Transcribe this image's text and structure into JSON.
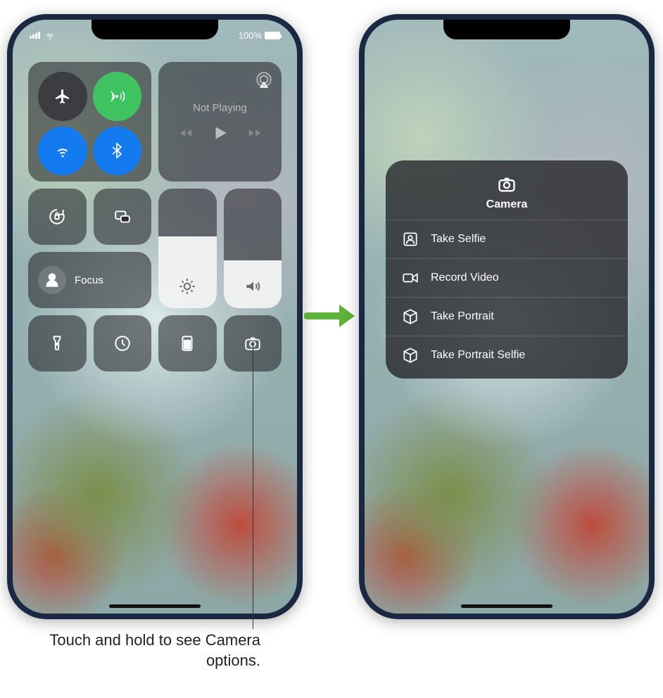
{
  "status": {
    "battery_pct": "100%"
  },
  "media": {
    "label": "Not Playing"
  },
  "focus": {
    "label": "Focus"
  },
  "sliders": {
    "brightness_pct": 60,
    "volume_pct": 40
  },
  "camera_menu": {
    "title": "Camera",
    "items": [
      {
        "label": "Take Selfie",
        "icon": "portrait-photo-icon"
      },
      {
        "label": "Record Video",
        "icon": "video-icon"
      },
      {
        "label": "Take Portrait",
        "icon": "cube-icon"
      },
      {
        "label": "Take Portrait Selfie",
        "icon": "cube-icon"
      }
    ]
  },
  "callout": "Touch and hold to see Camera options."
}
